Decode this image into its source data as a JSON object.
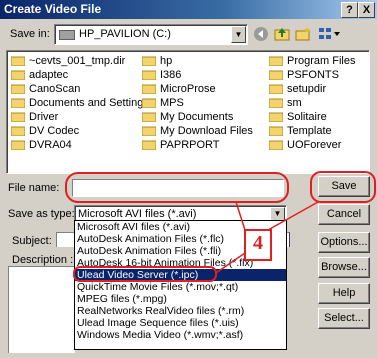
{
  "window": {
    "title": "Create Video File",
    "help_btn": "?",
    "close_btn": "X"
  },
  "toolbar": {
    "save_in_label": "Save in:",
    "location": "HP_PAVILION (C:)"
  },
  "files": {
    "col1": [
      "~cevts_001_tmp.dir",
      "adaptec",
      "CanoScan",
      "Documents and Settings",
      "Driver",
      "DV Codec",
      "DVRA04"
    ],
    "col2": [
      "hp",
      "I386",
      "MicroProse",
      "MPS",
      "My Documents",
      "My Download Files",
      "PAPRPORT"
    ],
    "col3": [
      "Program Files",
      "PSFONTS",
      "setupdir",
      "sm",
      "Solitaire",
      "Template",
      "UOForever"
    ]
  },
  "form": {
    "file_name_label": "File name:",
    "file_name_value": "",
    "save_type_label": "Save as type:",
    "save_type_value": "Microsoft AVI files (*.avi)",
    "subject_label": "Subject:",
    "description_label": "Description :"
  },
  "buttons": {
    "save": "Save",
    "cancel": "Cancel",
    "options": "Options...",
    "browse": "Browse...",
    "help": "Help",
    "select": "Select..."
  },
  "dropdown_options": [
    "Microsoft AVI files (*.avi)",
    "AutoDesk Animation Files (*.flc)",
    "AutoDesk Animation Files (*.fli)",
    "AutoDesk 16-bit Animation Files (*.flx)",
    "Ulead Video Server (*.ipc)",
    "QuickTime Movie Files (*.mov;*.qt)",
    "MPEG files (*.mpg)",
    "RealNetworks RealVideo files (*.rm)",
    "Ulead Image Sequence files (*.uis)",
    "Windows Media Video (*.wmv;*.asf)"
  ],
  "annotation": {
    "step_number": "4",
    "color": "#e02020"
  },
  "colors": {
    "titlebar": "#0a246a",
    "folder": "#f3d36b",
    "highlight": "#e02020"
  }
}
